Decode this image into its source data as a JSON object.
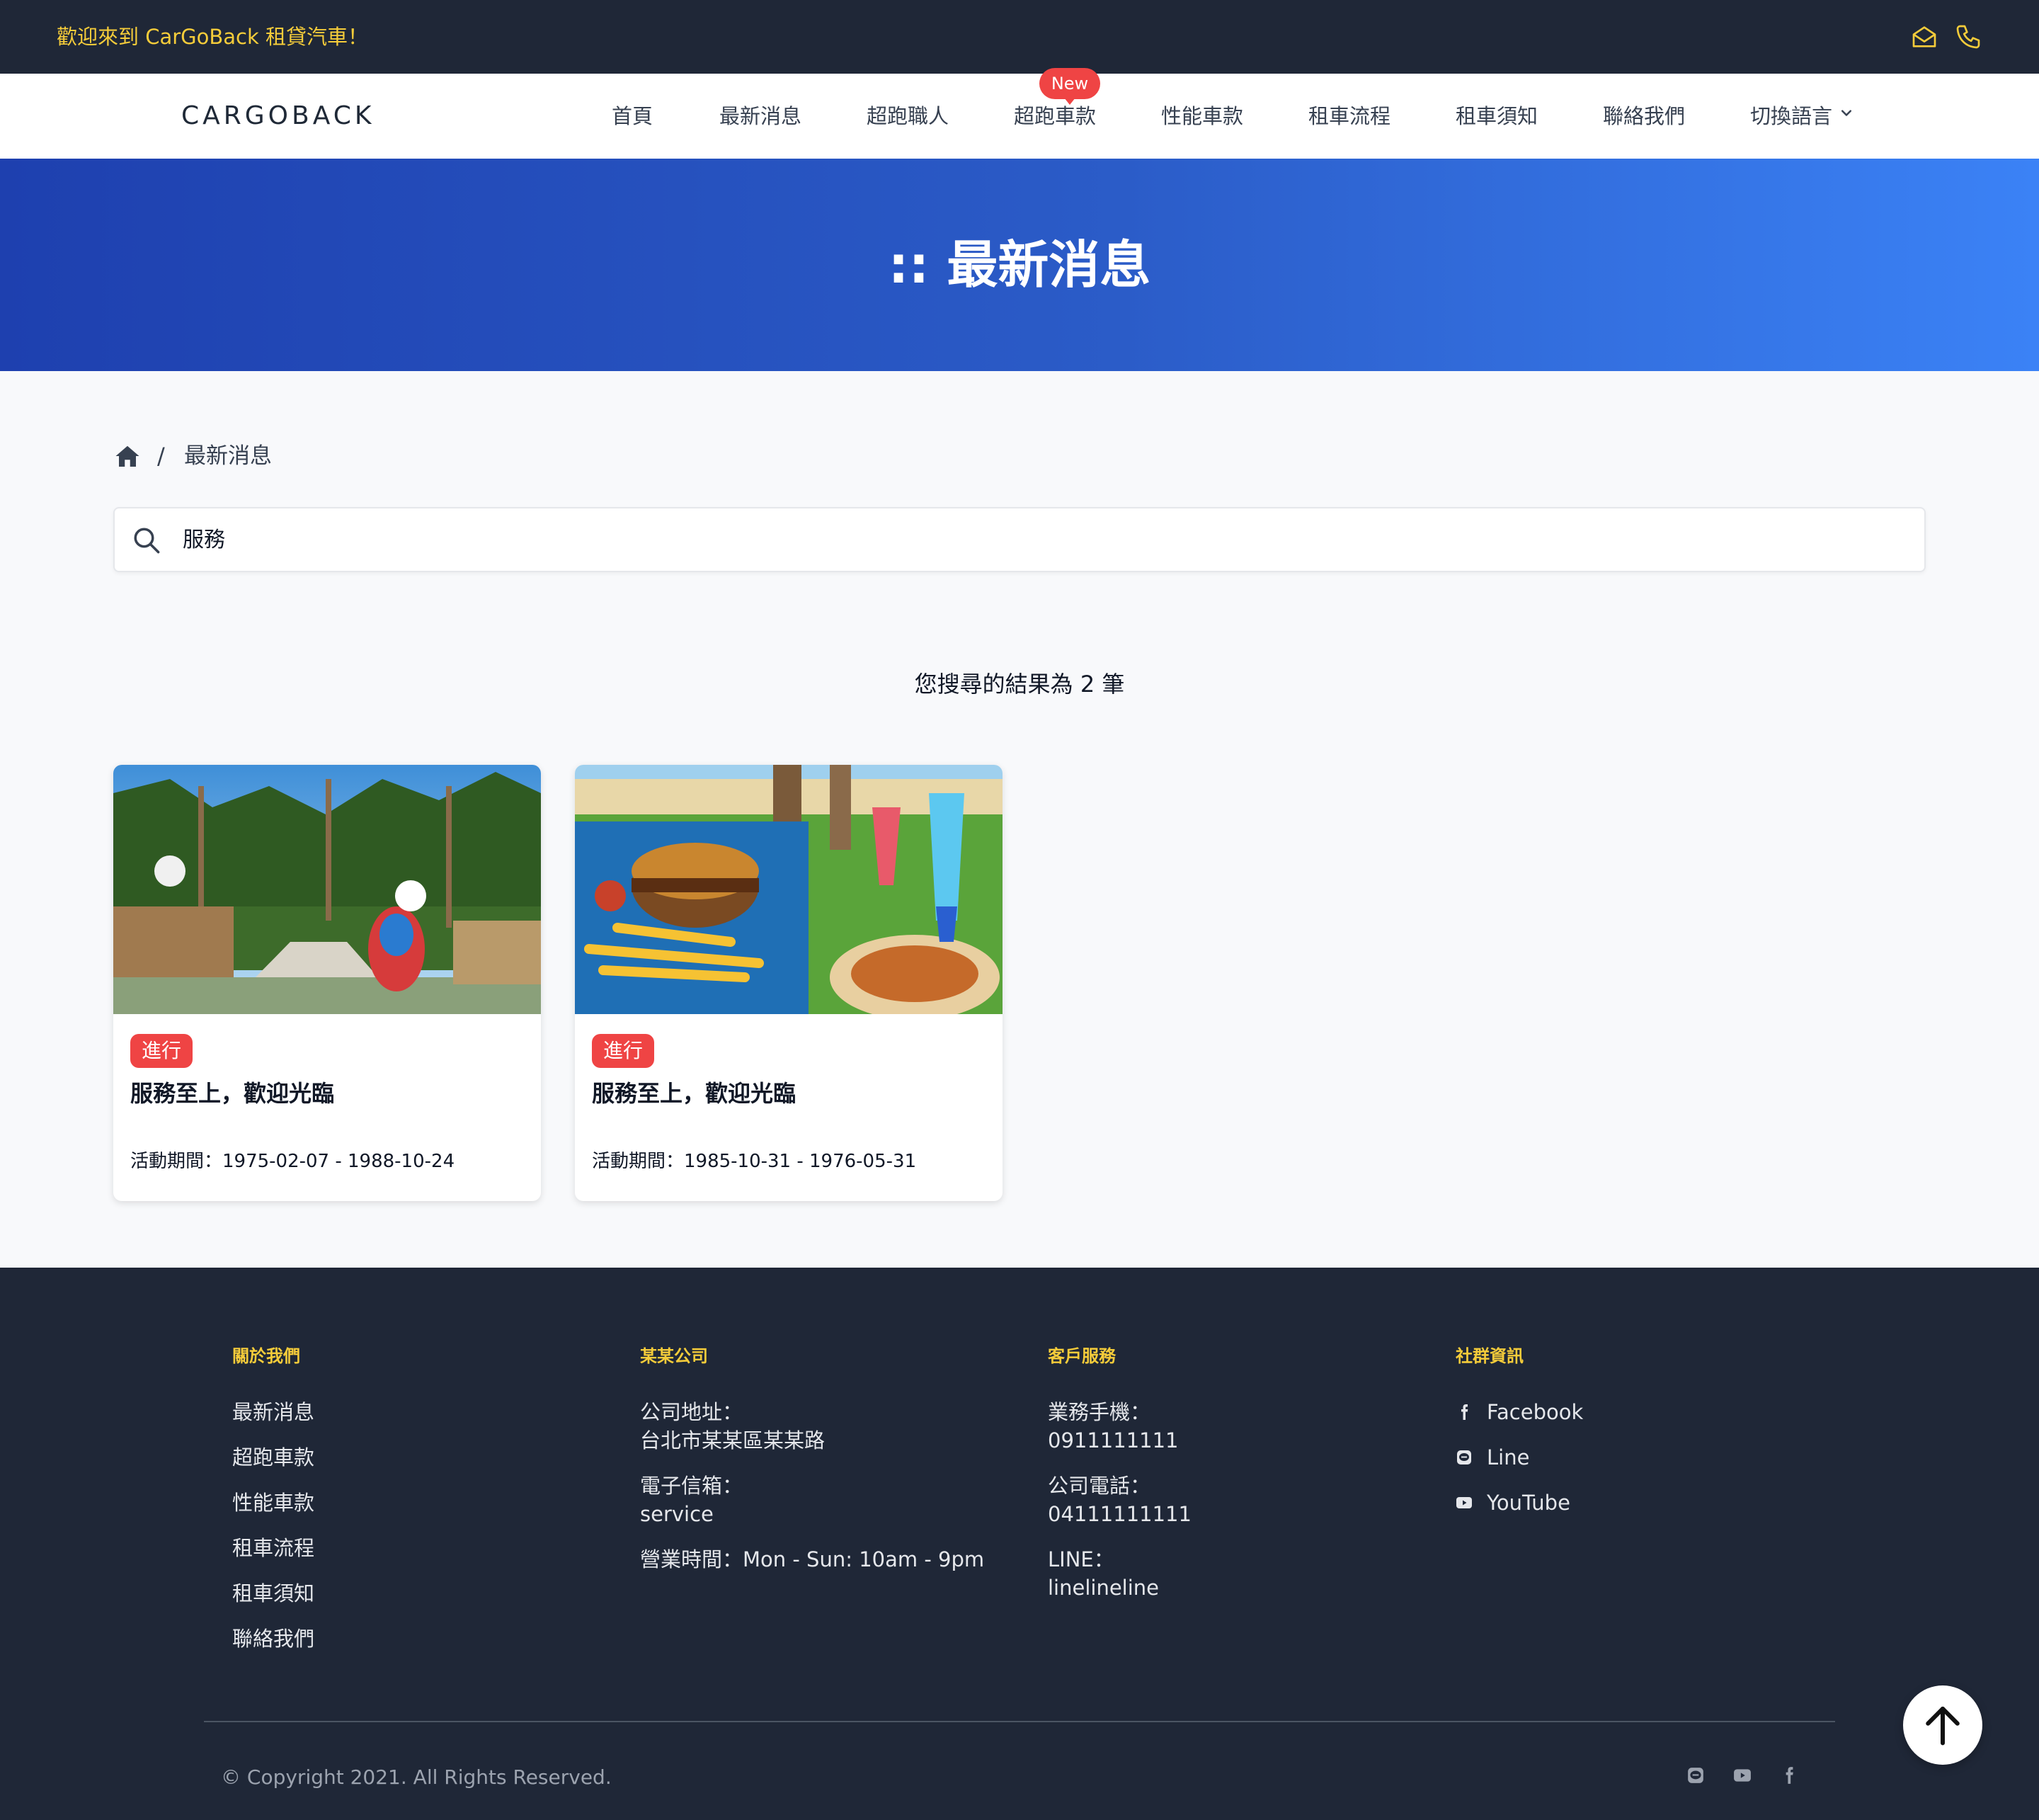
{
  "topbar": {
    "welcome": "歡迎來到 CarGoBack 租貸汽車！",
    "icons": [
      "mail-icon",
      "phone-icon"
    ]
  },
  "navbar": {
    "logo": "CARGOBACK",
    "items": [
      "首頁",
      "最新消息",
      "超跑職人",
      "超跑車款",
      "性能車款",
      "租車流程",
      "租車須知",
      "聯絡我們",
      "切換語言"
    ],
    "new_badge": "New"
  },
  "hero": {
    "title": ":: 最新消息"
  },
  "breadcrumb": {
    "separator": "/",
    "current": "最新消息"
  },
  "search": {
    "value": "服務"
  },
  "results": {
    "summary": "您搜尋的結果為 2 筆"
  },
  "cards": [
    {
      "badge": "進行",
      "title": "服務至上，歡迎光臨",
      "period": "活動期間：1975-02-07 - 1988-10-24"
    },
    {
      "badge": "進行",
      "title": "服務至上，歡迎光臨",
      "period": "活動期間：1985-10-31 - 1976-05-31"
    }
  ],
  "footer": {
    "about": {
      "heading": "關於我們",
      "links": [
        "最新消息",
        "超跑車款",
        "性能車款",
        "租車流程",
        "租車須知",
        "聯絡我們"
      ]
    },
    "company": {
      "heading": "某某公司",
      "address_label": "公司地址：",
      "address": "台北市某某區某某路",
      "email_label": "電子信箱：",
      "email": "service",
      "hours": "營業時間：Mon - Sun: 10am - 9pm"
    },
    "service": {
      "heading": "客戶服務",
      "mobile_label": "業務手機：",
      "mobile": "0911111111",
      "phone_label": "公司電話：",
      "phone": "04111111111",
      "line_label": "LINE：",
      "line": "linelineline"
    },
    "social": {
      "heading": "社群資訊",
      "facebook": "Facebook",
      "line": "Line",
      "youtube": "YouTube"
    },
    "copyright": "© Copyright 2021. All Rights Reserved."
  },
  "colors": {
    "dark": "#1f2737",
    "accent": "#f5cc3a",
    "badge": "#ef4444",
    "hero_from": "#1e40af",
    "hero_to": "#3b82f6"
  }
}
